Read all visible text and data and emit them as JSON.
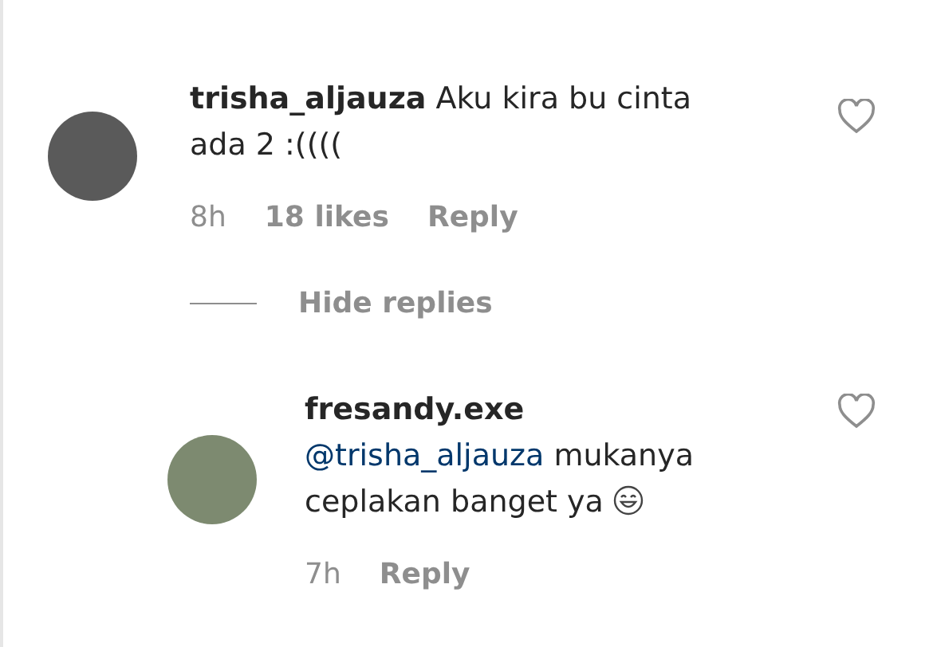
{
  "comments": [
    {
      "username": "trisha_aljauza",
      "text": "Aku kira bu cinta ada 2 :((((",
      "time": "8h",
      "likes": "18 likes",
      "reply": "Reply",
      "liked": false
    },
    {
      "username": "fresandy.exe",
      "mention": "@trisha_aljauza",
      "text": "mukanya ceplakan banget ya",
      "emoji": true,
      "time": "7h",
      "reply": "Reply",
      "liked": false
    }
  ],
  "hide_replies": "Hide replies"
}
